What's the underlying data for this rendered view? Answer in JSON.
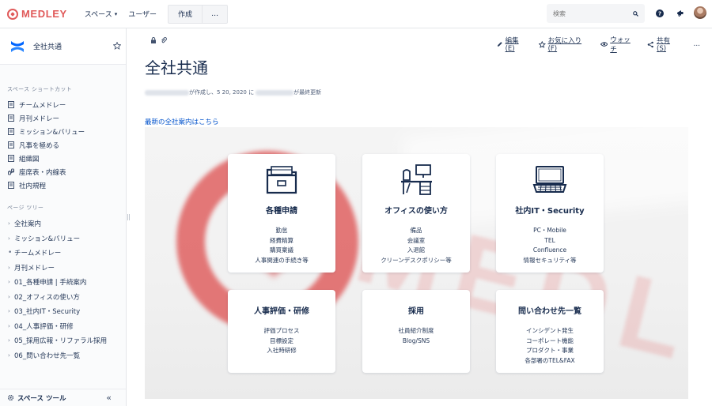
{
  "header": {
    "logo_text": "MEDLEY",
    "nav": {
      "spaces": "スペース",
      "users": "ユーザー"
    },
    "create_label": "作成",
    "more_label": "…",
    "search_placeholder": "検索"
  },
  "sidebar": {
    "space_name": "全社共通",
    "shortcuts_title": "スペース ショートカット",
    "shortcuts": [
      "チームメドレー",
      "月刊メドレー",
      "ミッション&バリュー",
      "凡事を極める",
      "組織図",
      "座席表・内線表",
      "社内規程"
    ],
    "tree_title": "ページ ツリー",
    "tree": [
      {
        "label": "全社案内",
        "marker": "›"
      },
      {
        "label": "ミッション&バリュー",
        "marker": "›"
      },
      {
        "label": "チームメドレー",
        "marker": "•"
      },
      {
        "label": "月刊メドレー",
        "marker": "›"
      },
      {
        "label": "01_各種申請 | 手続案内",
        "marker": "›"
      },
      {
        "label": "02_オフィスの使い方",
        "marker": "›"
      },
      {
        "label": "03_社内IT・Security",
        "marker": "›"
      },
      {
        "label": "04_人事評価・研修",
        "marker": "›"
      },
      {
        "label": "05_採用広報・リファラル採用",
        "marker": "›"
      },
      {
        "label": "06_問い合わせ先一覧",
        "marker": "›"
      }
    ],
    "footer_label": "スペース ツール",
    "collapse_label": "«"
  },
  "page": {
    "actions": {
      "edit": "編集(E)",
      "favorite": "お気に入り(F)",
      "watch": "ウォッチ",
      "share": "共有(S)",
      "more": "…"
    },
    "title": "全社共通",
    "meta": {
      "created_suffix": "が作成し、5 20, 2020 に",
      "updated_suffix": "が最終更新"
    },
    "link_text": "最新の全社案内はこちら",
    "cards": [
      {
        "title": "各種申請",
        "icon": "folder-icon",
        "items": [
          "勤怠",
          "経費精算",
          "購買稟議",
          "人事関連の手続き等"
        ]
      },
      {
        "title": "オフィスの使い方",
        "icon": "office-desk-icon",
        "items": [
          "備品",
          "会議室",
          "入退館",
          "クリーンデスクポリシー等"
        ]
      },
      {
        "title": "社内IT・Security",
        "icon": "laptop-icon",
        "items": [
          "PC・Mobile",
          "TEL",
          "Confluence",
          "情報セキュリティ等"
        ]
      },
      {
        "title": "人事評価・研修",
        "icon": "",
        "items": [
          "評価プロセス",
          "目標設定",
          "入社時研修"
        ]
      },
      {
        "title": "採用",
        "icon": "",
        "items": [
          "社員紹介制度",
          "Blog/SNS"
        ]
      },
      {
        "title": "問い合わせ先一覧",
        "icon": "",
        "items": [
          "インシデント発生",
          "コーポレート機能",
          "プロダクト・事業",
          "各部署のTEL&FAX"
        ]
      }
    ]
  },
  "colors": {
    "brand": "#e05a5a",
    "link": "#0052cc",
    "text": "#172b4d",
    "space_icon": "#0065ff"
  }
}
